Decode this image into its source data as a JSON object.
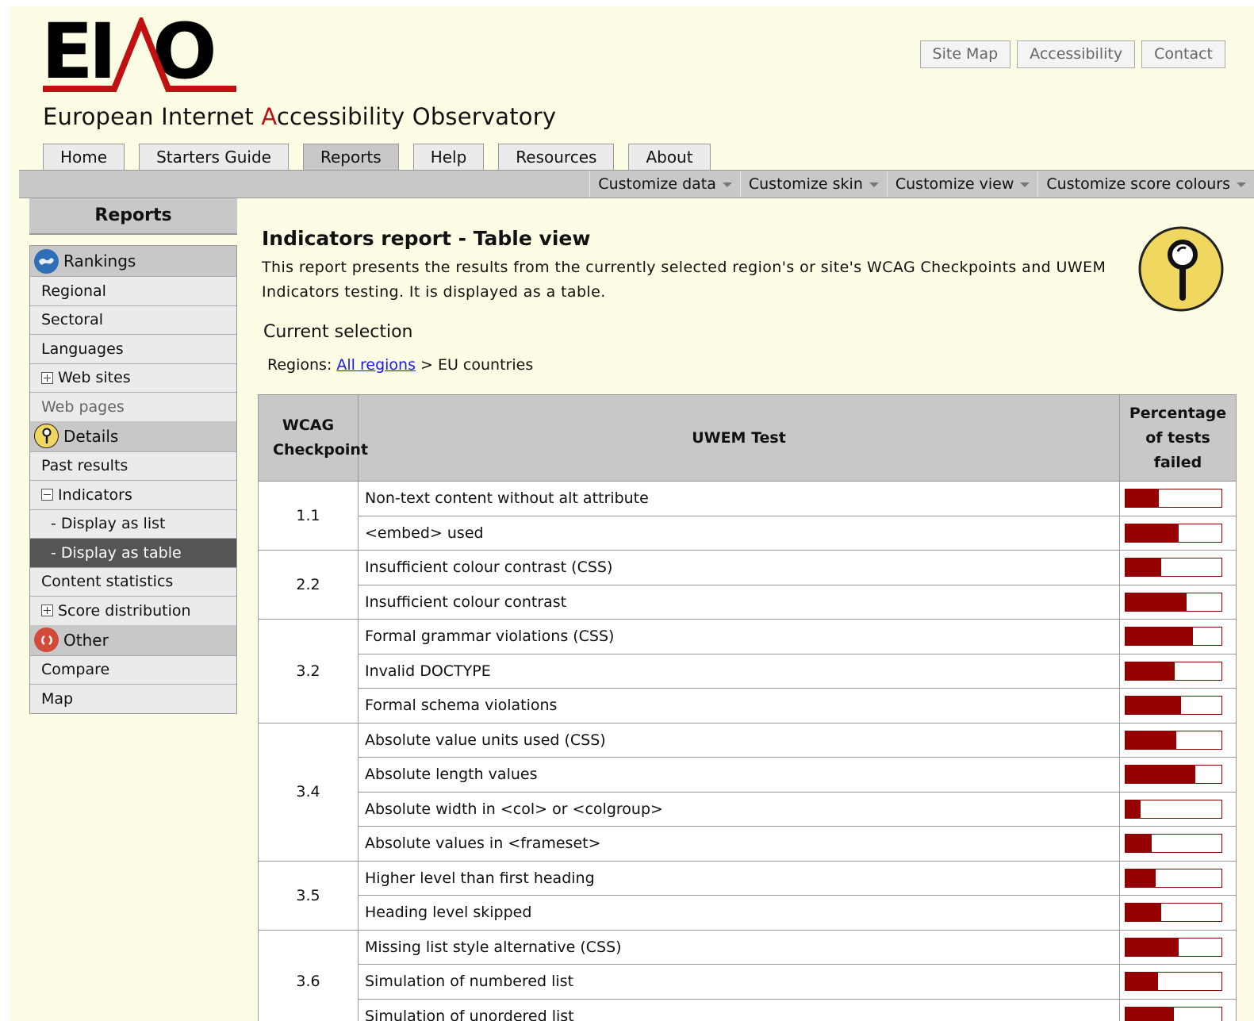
{
  "logo": {
    "text": "EIAO"
  },
  "subtitle": {
    "pre": "European Internet ",
    "red": "A",
    "post": "ccessibility Observatory"
  },
  "toplinks": [
    "Site Map",
    "Accessibility",
    "Contact"
  ],
  "tabs": [
    "Home",
    "Starters Guide",
    "Reports",
    "Help",
    "Resources",
    "About"
  ],
  "active_tab": "Reports",
  "submenus": [
    "Customize data",
    "Customize skin",
    "Customize view",
    "Customize score colours"
  ],
  "sidebar": {
    "title": "Reports",
    "rankings": "Rankings",
    "regional": "Regional",
    "sectoral": "Sectoral",
    "languages": "Languages",
    "web_sites": "Web sites",
    "web_pages": "Web pages",
    "details": "Details",
    "past_results": "Past results",
    "indicators": "Indicators",
    "display_list": "- Display as list",
    "display_table": "- Display as table",
    "content_statistics": "Content statistics",
    "score_distribution": "Score distribution",
    "other": "Other",
    "compare": "Compare",
    "map": "Map"
  },
  "content": {
    "title": "Indicators report - Table view",
    "description": "This report presents the results from the currently selected region's or site's WCAG Checkpoints and UWEM Indicators testing. It is displayed as a table.",
    "current_selection": "Current selection",
    "regions_label": "Regions:",
    "regions_link": "All regions",
    "regions_rest": " > EU countries"
  },
  "table": {
    "headers": {
      "checkpoint": "WCAG Checkpoint",
      "test": "UWEM Test",
      "percent": "Percentage of tests failed"
    },
    "rows": [
      {
        "checkpoint": "1.1",
        "span": 2,
        "test": "Non-text content without alt attribute",
        "failed": 0.35
      },
      {
        "test": "<embed> used",
        "failed": 0.55
      },
      {
        "checkpoint": "2.2",
        "span": 2,
        "test": "Insufficient colour contrast (CSS)",
        "failed": 0.37
      },
      {
        "test": "Insufficient colour contrast",
        "failed": 0.64
      },
      {
        "checkpoint": "3.2",
        "span": 3,
        "test": "Formal grammar violations (CSS)",
        "failed": 0.7
      },
      {
        "test": "Invalid DOCTYPE",
        "failed": 0.51
      },
      {
        "test": "Formal schema violations",
        "failed": 0.58
      },
      {
        "checkpoint": "3.4",
        "span": 4,
        "test": "Absolute value units used (CSS)",
        "failed": 0.53
      },
      {
        "test": "Absolute length values",
        "failed": 0.73
      },
      {
        "test": "Absolute width in <col> or <colgroup>",
        "failed": 0.16
      },
      {
        "test": "Absolute values in <frameset>",
        "failed": 0.27
      },
      {
        "checkpoint": "3.5",
        "span": 2,
        "test": "Higher level than first heading",
        "failed": 0.31
      },
      {
        "test": "Heading level skipped",
        "failed": 0.37
      },
      {
        "checkpoint": "3.6",
        "span": 3,
        "test": "Missing list style alternative (CSS)",
        "failed": 0.55
      },
      {
        "test": "Simulation of numbered list",
        "failed": 0.34
      },
      {
        "test": "Simulation of unordered list",
        "failed": 0.5
      }
    ]
  },
  "colors": {
    "bar": "#960000",
    "background": "#fdfde5",
    "grey": "#c8c8c8",
    "logo_red": "#c01010"
  }
}
